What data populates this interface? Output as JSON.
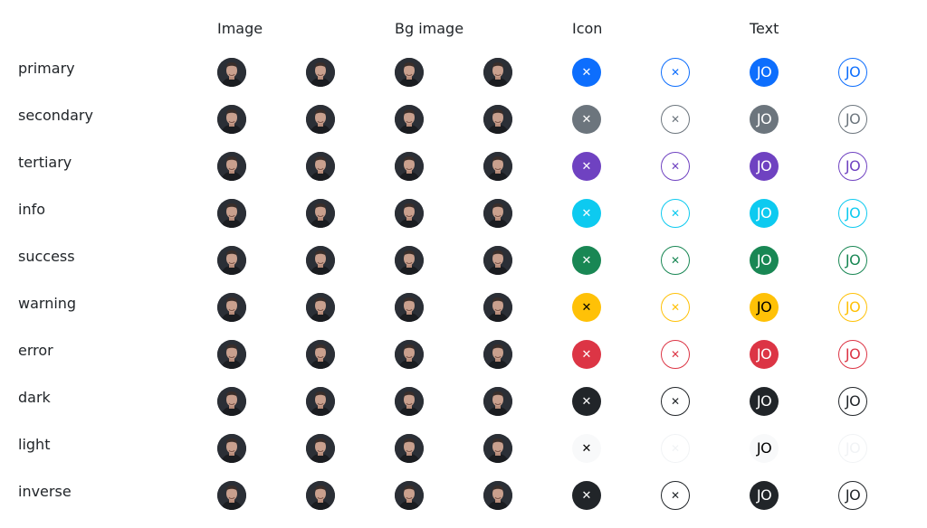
{
  "headers": [
    "Image",
    "Bg image",
    "Icon",
    "Text"
  ],
  "text_initials": "JO",
  "close_glyph": "✕",
  "image_icon": "person-photo-avatar",
  "rows": [
    {
      "name": "primary",
      "bg": "#0d6efd",
      "fg": "#ffffff",
      "outline": "#0d6efd"
    },
    {
      "name": "secondary",
      "bg": "#6c757d",
      "fg": "#ffffff",
      "outline": "#6c757d"
    },
    {
      "name": "tertiary",
      "bg": "#6f42c1",
      "fg": "#ffffff",
      "outline": "#6f42c1"
    },
    {
      "name": "info",
      "bg": "#0dcaf0",
      "fg": "#ffffff",
      "outline": "#0dcaf0"
    },
    {
      "name": "success",
      "bg": "#198754",
      "fg": "#ffffff",
      "outline": "#198754"
    },
    {
      "name": "warning",
      "bg": "#ffc107",
      "fg": "#000000",
      "outline": "#ffc107"
    },
    {
      "name": "error",
      "bg": "#dc3545",
      "fg": "#ffffff",
      "outline": "#dc3545"
    },
    {
      "name": "dark",
      "bg": "#212529",
      "fg": "#ffffff",
      "outline": "#212529"
    },
    {
      "name": "light",
      "bg": "#f8f9fa",
      "fg": "#000000",
      "outline": "#f1f3f5"
    },
    {
      "name": "inverse",
      "bg": "#212529",
      "fg": "#ffffff",
      "outline": "#212529"
    }
  ]
}
